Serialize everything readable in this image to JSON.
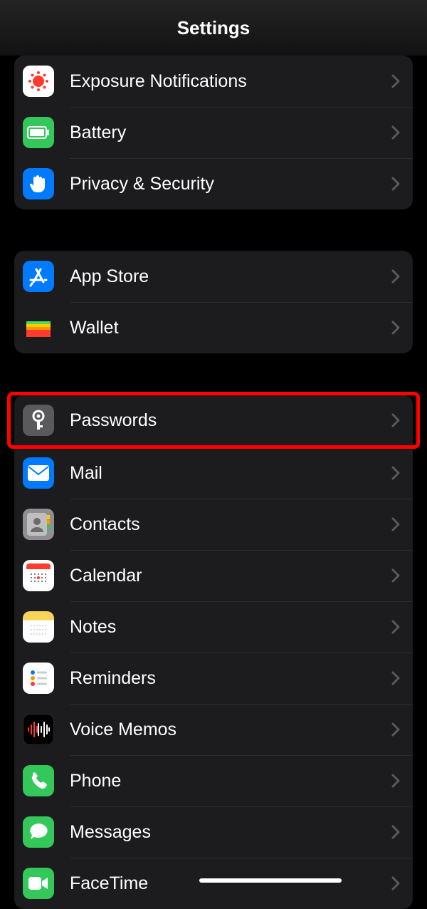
{
  "header": {
    "title": "Settings"
  },
  "group1": [
    {
      "label": "Exposure Notifications"
    },
    {
      "label": "Battery"
    },
    {
      "label": "Privacy & Security"
    }
  ],
  "group2": [
    {
      "label": "App Store"
    },
    {
      "label": "Wallet"
    }
  ],
  "group3": [
    {
      "label": "Passwords"
    },
    {
      "label": "Mail"
    },
    {
      "label": "Contacts"
    },
    {
      "label": "Calendar"
    },
    {
      "label": "Notes"
    },
    {
      "label": "Reminders"
    },
    {
      "label": "Voice Memos"
    },
    {
      "label": "Phone"
    },
    {
      "label": "Messages"
    },
    {
      "label": "FaceTime"
    }
  ]
}
